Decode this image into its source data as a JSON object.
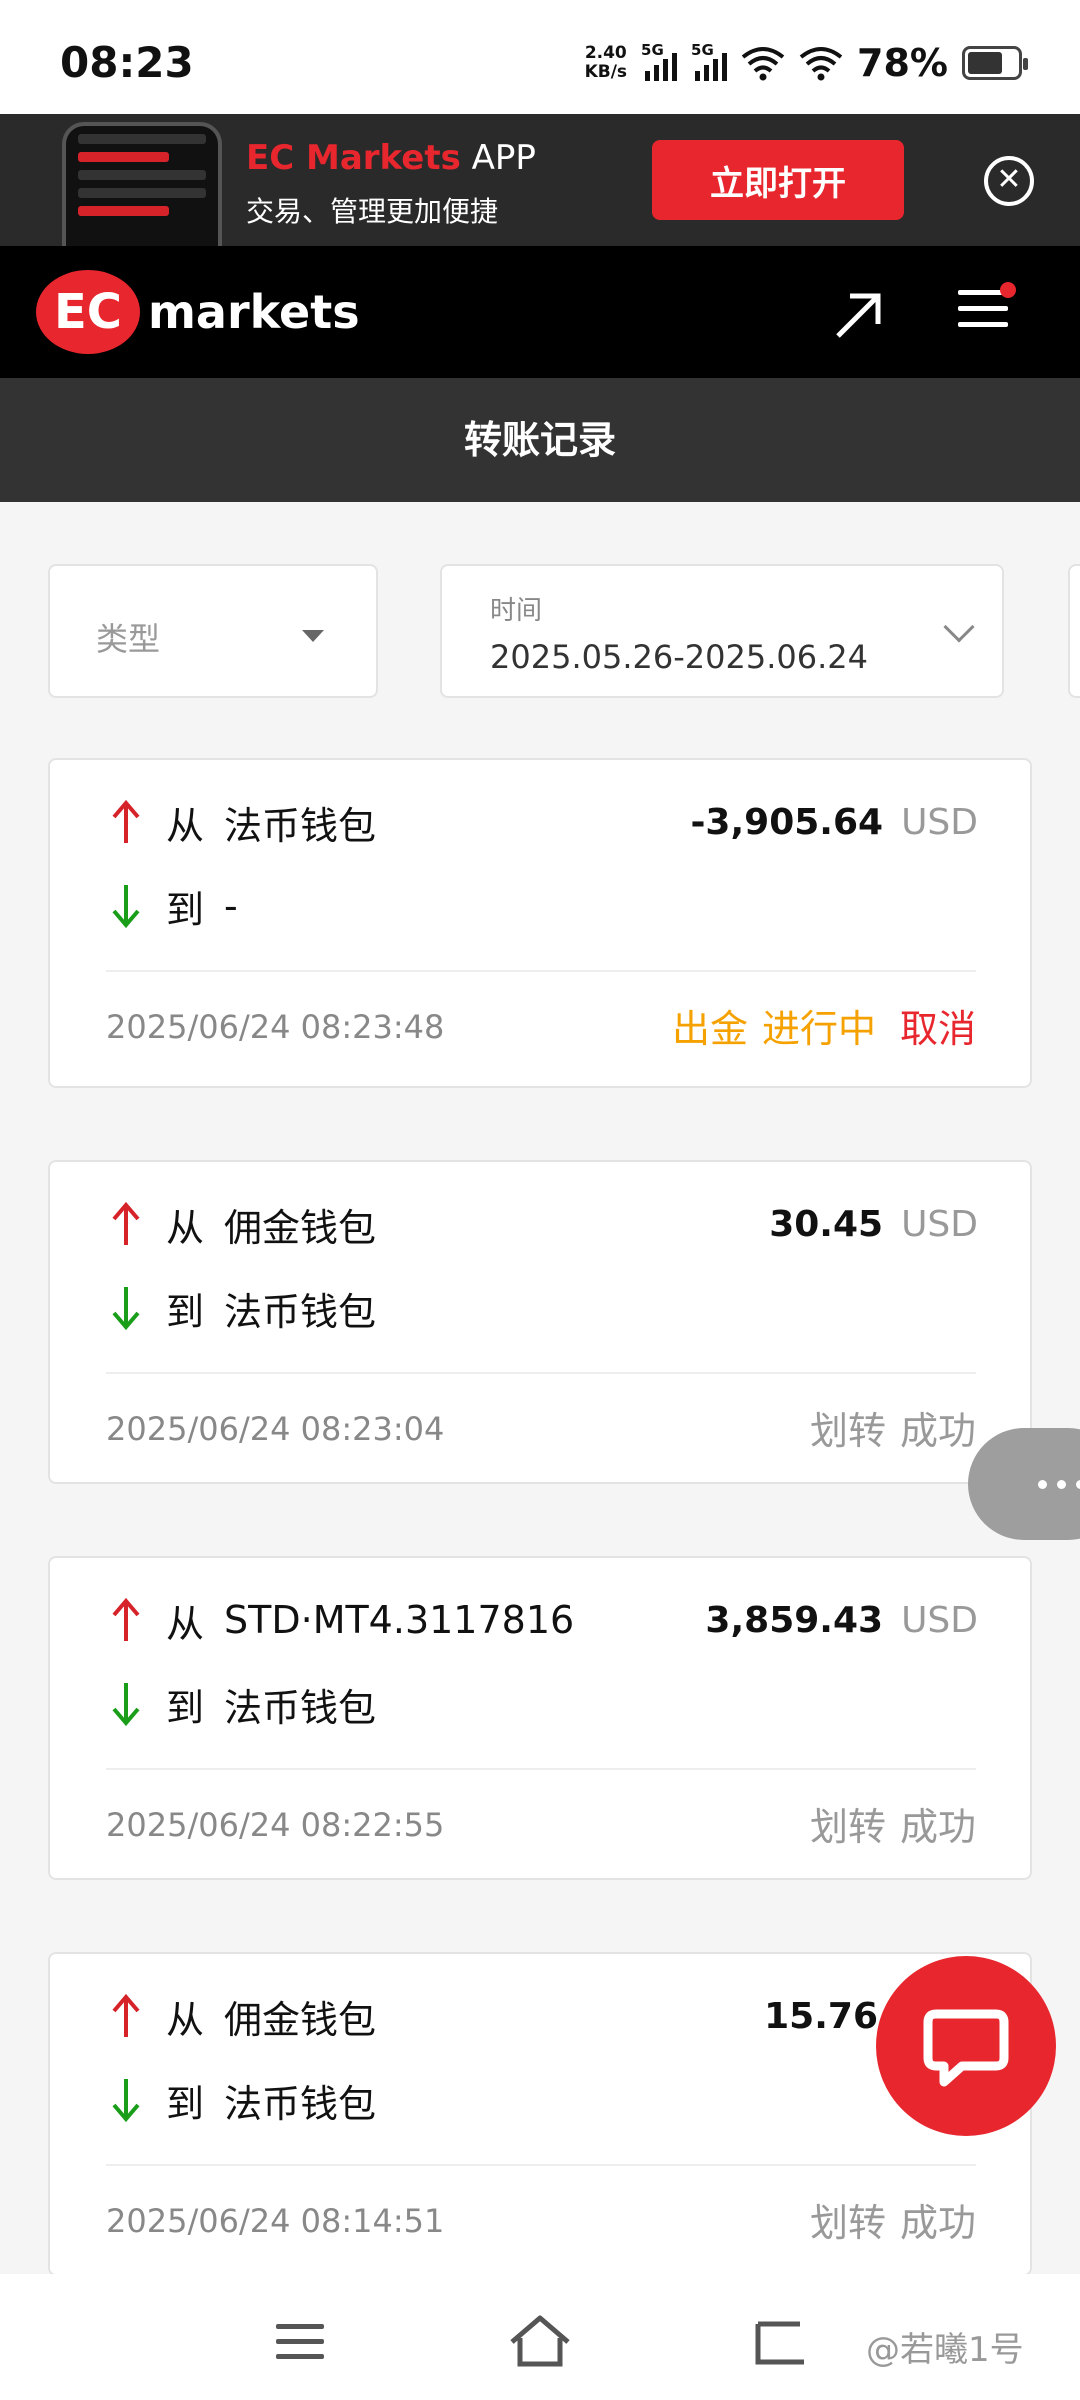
{
  "status_bar": {
    "time": "08:23",
    "net_speed_value": "2.40",
    "net_speed_unit": "KB/s",
    "sim1_label": "5G",
    "sim2_label": "5G",
    "battery": "78%"
  },
  "app_banner": {
    "brand": "EC Markets",
    "app": " APP",
    "subtitle": "交易、管理更加便捷",
    "open_button": "立即打开"
  },
  "header": {
    "logo_mark": "EC",
    "logo_text": "markets"
  },
  "page_title": "转账记录",
  "filters": {
    "type_placeholder": "类型",
    "time_label": "时间",
    "time_range": "2025.05.26-2025.06.24"
  },
  "records": [
    {
      "from_prefix": "从",
      "from": "法币钱包",
      "to_prefix": "到",
      "to": "-",
      "amount": "-3,905.64",
      "currency": "USD",
      "datetime": "2025/06/24 08:23:48",
      "status_type": "出金",
      "status_state": "进行中",
      "cancel": "取消"
    },
    {
      "from_prefix": "从",
      "from": "佣金钱包",
      "to_prefix": "到",
      "to": "法币钱包",
      "amount": "30.45",
      "currency": "USD",
      "datetime": "2025/06/24 08:23:04",
      "status_type": "划转",
      "status_state": "成功"
    },
    {
      "from_prefix": "从",
      "from": "STD·MT4.3117816",
      "to_prefix": "到",
      "to": "法币钱包",
      "amount": "3,859.43",
      "currency": "USD",
      "datetime": "2025/06/24 08:22:55",
      "status_type": "划转",
      "status_state": "成功"
    },
    {
      "from_prefix": "从",
      "from": "佣金钱包",
      "to_prefix": "到",
      "to": "法币钱包",
      "amount": "15.76",
      "datetime": "2025/06/24 08:14:51",
      "status_type": "划转",
      "status_state": "成功"
    }
  ],
  "watermark": "@若曦1号",
  "colors": {
    "brand_red": "#e8262e",
    "pending_orange": "#f5a100",
    "arrow_up": "#d6232a",
    "arrow_down": "#1a9e1a"
  }
}
